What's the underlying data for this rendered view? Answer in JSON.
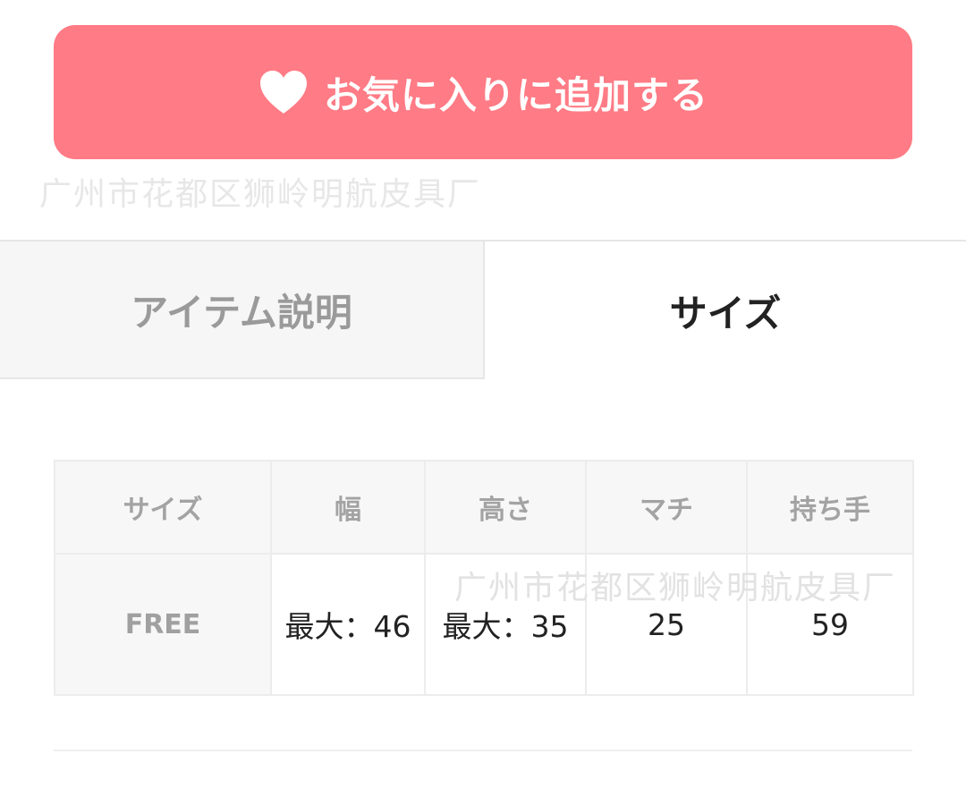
{
  "favorite_button": {
    "label": "お気に入りに追加する",
    "icon": "heart-icon",
    "background_color": "#ff7b85"
  },
  "watermark": {
    "text": "广州市花都区狮岭明航皮具厂"
  },
  "tabs": [
    {
      "label": "アイテム説明",
      "active": false
    },
    {
      "label": "サイズ",
      "active": true
    }
  ],
  "size_table": {
    "headers": [
      "サイズ",
      "幅",
      "高さ",
      "マチ",
      "持ち手"
    ],
    "rows": [
      [
        "FREE",
        "最大：46",
        "最大：35",
        "25",
        "59"
      ]
    ]
  }
}
